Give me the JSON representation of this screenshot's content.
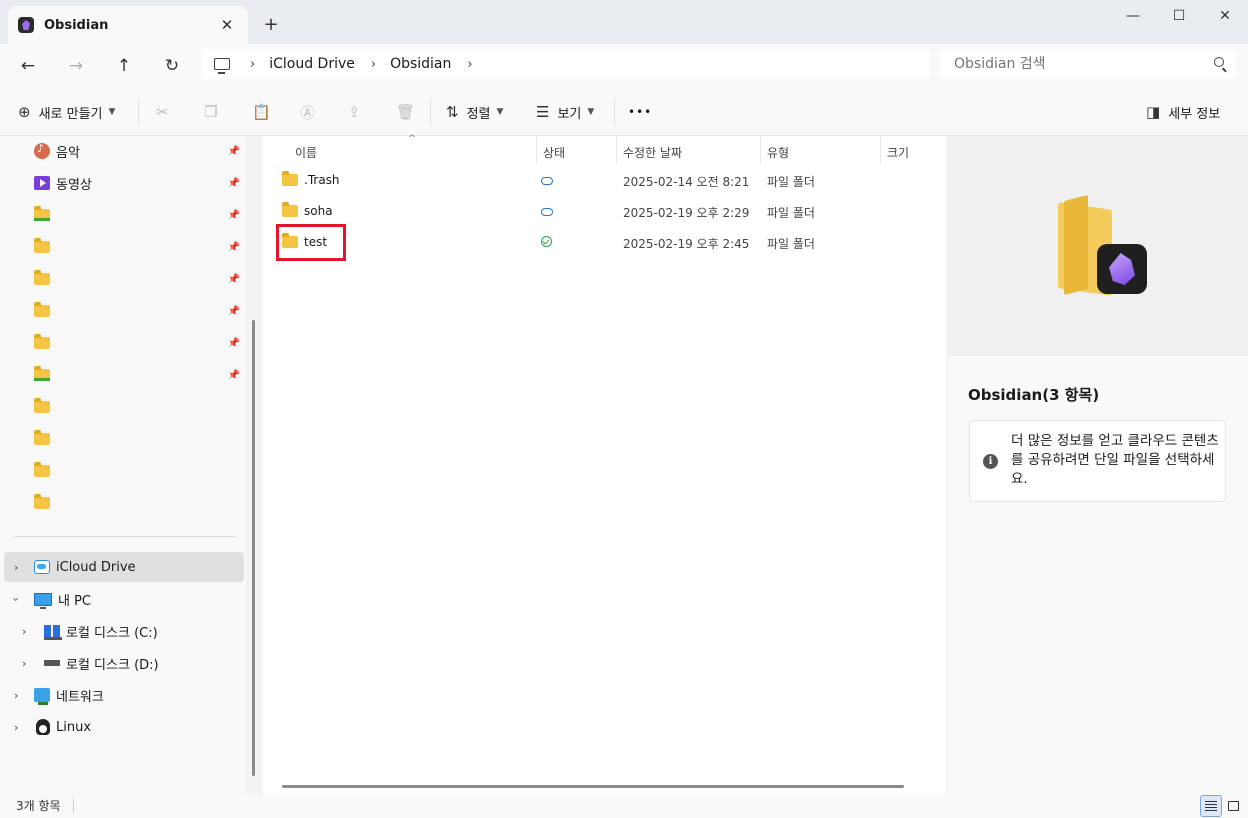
{
  "window": {
    "tab_title": "Obsidian",
    "close_tab": "✕",
    "new_tab": "+",
    "minimize": "—",
    "maximize": "☐",
    "close": "✕"
  },
  "nav": {
    "back": "←",
    "forward": "→",
    "up": "↑",
    "refresh": "↻"
  },
  "breadcrumb": [
    "iCloud Drive",
    "Obsidian"
  ],
  "search": {
    "placeholder": "Obsidian 검색"
  },
  "toolbar": {
    "new_label": "새로 만들기",
    "sort_label": "정렬",
    "view_label": "보기",
    "more_label": "•••",
    "details_label": "세부 정보"
  },
  "sidebar": {
    "quick_access": [
      {
        "label": "음악",
        "icon": "music-icon",
        "pinned": true
      },
      {
        "label": "동영상",
        "icon": "video-icon",
        "pinned": true
      },
      {
        "label": "",
        "icon": "folder-icon",
        "pinned": true
      },
      {
        "label": "",
        "icon": "folder-icon",
        "pinned": true
      },
      {
        "label": "",
        "icon": "folder-icon",
        "pinned": true
      },
      {
        "label": "",
        "icon": "folder-icon",
        "pinned": true
      },
      {
        "label": "",
        "icon": "folder-icon",
        "pinned": true
      },
      {
        "label": "",
        "icon": "folder-icon",
        "pinned": true
      },
      {
        "label": "",
        "icon": "folder-icon",
        "pinned": false
      },
      {
        "label": "",
        "icon": "folder-icon",
        "pinned": false
      },
      {
        "label": "",
        "icon": "folder-icon",
        "pinned": false
      },
      {
        "label": "",
        "icon": "folder-icon",
        "pinned": false
      }
    ],
    "tree": [
      {
        "label": "iCloud Drive",
        "icon": "icloud-icon",
        "selected": true
      },
      {
        "label": "내 PC",
        "icon": "monitor-icon",
        "expanded": true
      },
      {
        "label": "로컬 디스크 (C:)",
        "icon": "disk-c-icon"
      },
      {
        "label": "로컬 디스크 (D:)",
        "icon": "disk-d-icon"
      },
      {
        "label": "네트워크",
        "icon": "network-icon"
      },
      {
        "label": "Linux",
        "icon": "linux-icon"
      }
    ]
  },
  "filelist": {
    "columns": [
      "이름",
      "상태",
      "수정한 날짜",
      "유형",
      "크기"
    ],
    "rows": [
      {
        "name": ".Trash",
        "status": "cloud",
        "date": "2025-02-14 오전 8:21",
        "type": "파일 폴더"
      },
      {
        "name": "soha",
        "status": "cloud",
        "date": "2025-02-19 오후 2:29",
        "type": "파일 폴더"
      },
      {
        "name": "test",
        "status": "synced",
        "date": "2025-02-19 오후 2:45",
        "type": "파일 폴더"
      }
    ]
  },
  "details": {
    "title": "Obsidian(3 항목)",
    "info_icon": "i",
    "info_text": "더 많은 정보를 얻고 클라우드 콘텐츠를 공유하려면 단일 파일을 선택하세요."
  },
  "statusbar": {
    "count": "3개 항목"
  },
  "colors": {
    "highlight": "#e2162a",
    "folder": "#f4c542",
    "accent": "#7b45e0"
  }
}
